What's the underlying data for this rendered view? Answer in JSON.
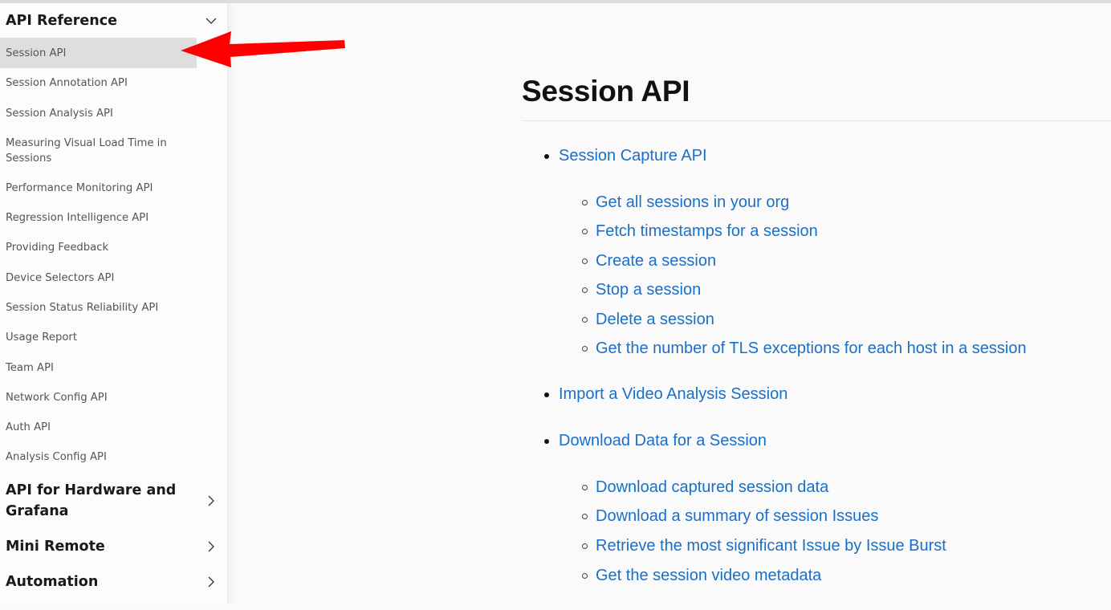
{
  "sidebar": {
    "section_expanded": {
      "label": "API Reference",
      "icon": "chevron-down-icon"
    },
    "items": [
      {
        "label": "Session API",
        "active": true
      },
      {
        "label": "Session Annotation API"
      },
      {
        "label": "Session Analysis API"
      },
      {
        "label": "Measuring Visual Load Time in Sessions"
      },
      {
        "label": "Performance Monitoring API"
      },
      {
        "label": "Regression Intelligence API"
      },
      {
        "label": "Providing Feedback"
      },
      {
        "label": "Device Selectors API"
      },
      {
        "label": "Session Status Reliability API"
      },
      {
        "label": "Usage Report"
      },
      {
        "label": "Team API"
      },
      {
        "label": "Network Config API"
      },
      {
        "label": "Auth API"
      },
      {
        "label": "Analysis Config API"
      }
    ],
    "sections_collapsed": [
      {
        "label": "API for Hardware and Grafana",
        "icon": "chevron-right-icon"
      },
      {
        "label": "Mini Remote",
        "icon": "chevron-right-icon"
      },
      {
        "label": "Automation",
        "icon": "chevron-right-icon"
      }
    ]
  },
  "annotation": {
    "type": "red-arrow",
    "color": "#ff0000",
    "points_to": "Session API"
  },
  "main": {
    "title": "Session API",
    "toc": [
      {
        "label": "Session Capture API",
        "children": [
          "Get all sessions in your org",
          "Fetch timestamps for a session",
          "Create a session",
          "Stop a session",
          "Delete a session",
          "Get the number of TLS exceptions for each host in a session"
        ]
      },
      {
        "label": "Import a Video Analysis Session",
        "children": []
      },
      {
        "label": "Download Data for a Session",
        "children": [
          "Download captured session data",
          "Download a summary of session Issues",
          "Retrieve the most significant Issue by Issue Burst",
          "Get the session video metadata"
        ]
      }
    ]
  },
  "colors": {
    "link": "#1a6fc9",
    "active_bg": "#dedede",
    "arrow": "#ff0000"
  }
}
